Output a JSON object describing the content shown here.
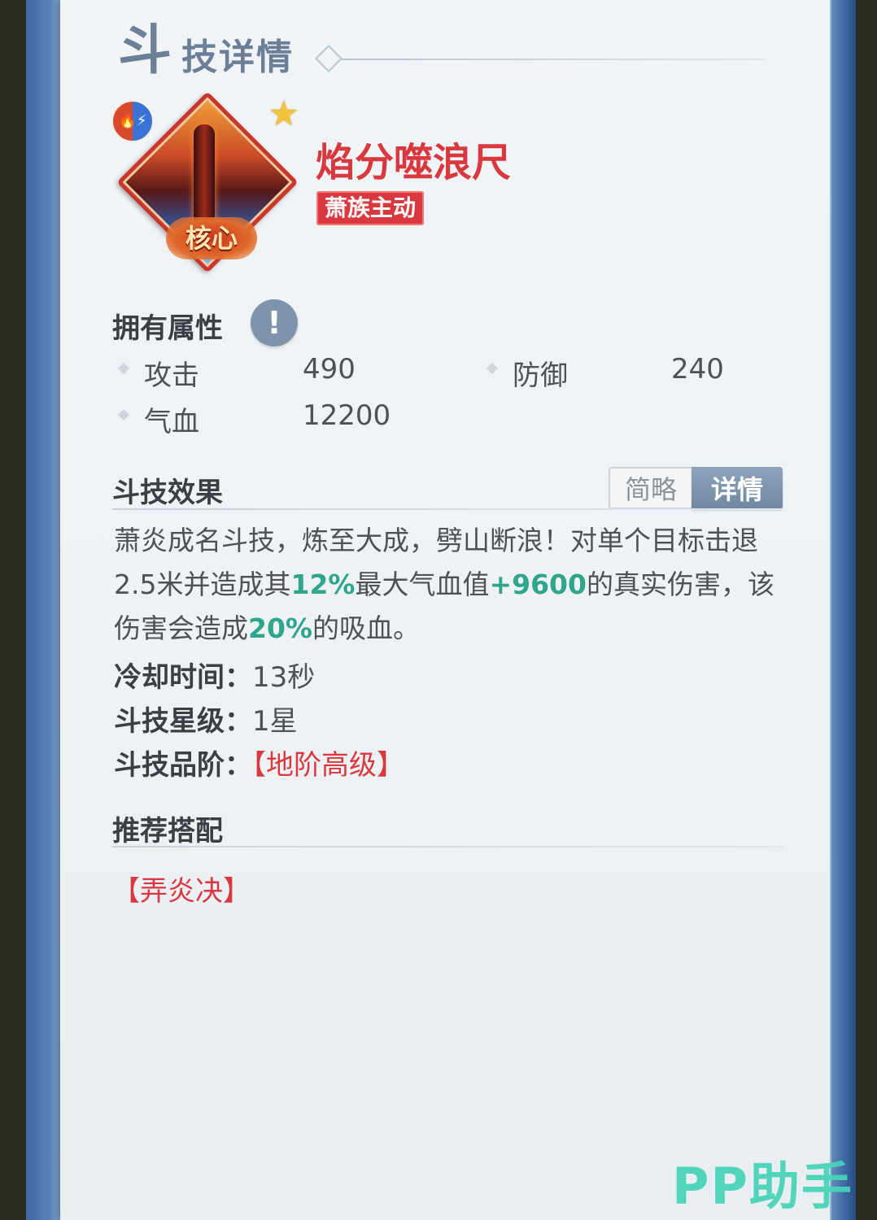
{
  "header": {
    "title_first_char": "斗",
    "title_rest": "技详情"
  },
  "skill": {
    "icon_name": "flame-pillar-skill-icon",
    "element_icon_name": "fire-lightning-element-icon",
    "star_icon_name": "star-icon",
    "core_label": "核心",
    "name": "焰分噬浪尺",
    "tag": "萧族主动",
    "name_color": "#d8383e"
  },
  "attributes": {
    "section_title": "拥有属性",
    "info_button_label": "!",
    "items": [
      {
        "label": "攻击",
        "value": "490"
      },
      {
        "label": "防御",
        "value": "240"
      },
      {
        "label": "气血",
        "value": "12200"
      }
    ]
  },
  "effect": {
    "section_title": "斗技效果",
    "toggle_brief": "简略",
    "toggle_detail": "详情",
    "selected_tab": "详情",
    "desc_1": "萧炎成名斗技，炼至大成，劈山断浪！对单个目标击退2.5米并造成其",
    "desc_hl_1": "12%",
    "desc_2": "最大气血值",
    "desc_hl_2": "+9600",
    "desc_3": "的真实伤害，该伤害会造成",
    "desc_hl_3": "20%",
    "desc_4": "的吸血。",
    "highlight_color": "#2fa58a",
    "cooldown_key": "冷却时间：",
    "cooldown_value": "13秒",
    "star_key": "斗技星级：",
    "star_value": "1星",
    "grade_key": "斗技品阶：",
    "grade_value": "【地阶高级】"
  },
  "recommend": {
    "section_title": "推荐搭配",
    "item": "【弄炎决】"
  },
  "watermark": "PP助手"
}
